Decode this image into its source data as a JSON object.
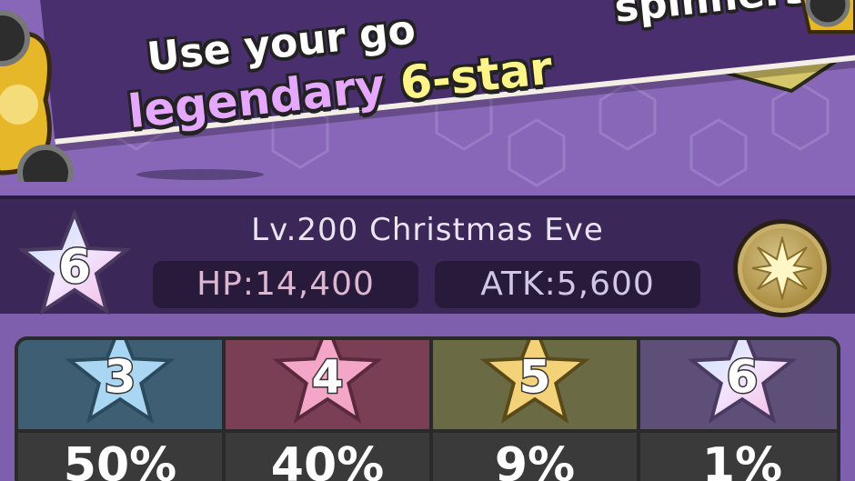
{
  "banner": {
    "line1": "Use your go",
    "line1_tail": "spinners",
    "word_legendary": "legendary",
    "word_sixstar": "6-star"
  },
  "unit": {
    "name": "Lv.200 Christmas Eve",
    "hp": "HP:14,400",
    "atk": "ATK:5,600",
    "rarity": "6",
    "element_icon": "starburst-coin-icon"
  },
  "odds": [
    {
      "stars": "3",
      "percent": "50%",
      "color": "#3e5f73",
      "star_color": "#a9d6f2"
    },
    {
      "stars": "4",
      "percent": "40%",
      "color": "#7a3e55",
      "star_color": "#f4a6c8"
    },
    {
      "stars": "5",
      "percent": "9%",
      "color": "#6a6a44",
      "star_color": "#f3d27a"
    },
    {
      "stars": "6",
      "percent": "1%",
      "color": "#5e4f78",
      "star_color": "#d9c6f5"
    }
  ]
}
